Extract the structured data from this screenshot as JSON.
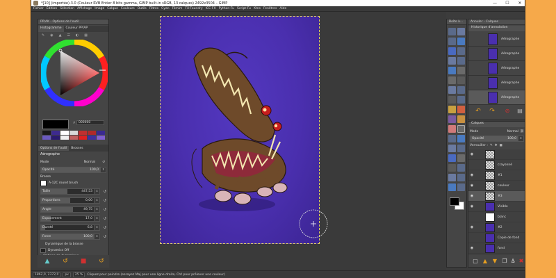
{
  "window": {
    "title": "*[10] (importée)-3.0 (Couleur RVB Entier 8 bits gamma, GIMP built-in sRGB, 13 calques) 2492x3504 – GIMP",
    "controls": [
      "—",
      "☐",
      "✕"
    ]
  },
  "menu": [
    "Fichier",
    "Édition",
    "Sélection",
    "Affichage",
    "Image",
    "Calque",
    "Couleurs",
    "Outils",
    "Filtres",
    "Cyan",
    "Filmim",
    "FX-Foundry",
    "ICC-FX",
    "Python-Fu",
    "Script-Fu",
    "Xtns",
    "Fenêtres",
    "Aide"
  ],
  "left_panel": {
    "dock_title": "PP/AK - Options de l'outil",
    "tabs": [
      "Histogramme",
      "Couleur PP/AP"
    ],
    "hex_value": "000000",
    "colors": {
      "foreground": "#000000",
      "swatches": [
        "#1a1a1a",
        "#3d2a8f",
        "#ffffff",
        "#d8d8d8",
        "#c03030",
        "#b02a2a",
        "#3a2a90",
        "#6a5ac0",
        "#2a1a70",
        "#f0f0f0",
        "#c06060",
        "#e02020",
        "#4030a0",
        "#8060d0"
      ]
    },
    "options_tabs": [
      "Options de l'outil",
      "Brosses"
    ],
    "tool_name": "Aérographe",
    "mode_label": "Mode",
    "mode_value": "Normal",
    "opacity": {
      "label": "Opacité",
      "value": "100,0",
      "fraction": 1.0
    },
    "brush_label": "Brosse",
    "brush_value": "A-12C round brush",
    "sliders": [
      {
        "label": "Taille",
        "value": "447,53",
        "fraction": 0.45
      },
      {
        "label": "Proportions",
        "value": "0,00",
        "fraction": 0.5
      },
      {
        "label": "Angle",
        "value": "49,75",
        "fraction": 0.55
      },
      {
        "label": "Espacement",
        "value": "17,0",
        "fraction": 0.17
      },
      {
        "label": "Dureté",
        "value": "6,8",
        "fraction": 0.07
      },
      {
        "label": "Force",
        "value": "100,0",
        "fraction": 1.0
      }
    ],
    "dynamics_label": "Dynamique de la brosse",
    "dynamics_value": "Dynamics Off",
    "dynamics_options": "Options de dynamique"
  },
  "right_panel": {
    "toolbox_title": "Boîte à...",
    "history_title": "Annuler - Calques",
    "history_header": "Historique d'annulation",
    "history": [
      "Aérographe",
      "Aérographe",
      "Aérographe",
      "Aérographe",
      "Aérographe"
    ],
    "layers_tab": "Calques",
    "mode_label": "Mode",
    "mode_value": "Normal",
    "opacity_label": "Opacité",
    "opacity_value": "100,0",
    "lock_label": "Verrouiller :",
    "layers": [
      {
        "name": "",
        "thumb": "checker"
      },
      {
        "name": "crayonné",
        "thumb": "checker"
      },
      {
        "name": "#1",
        "thumb": "checker"
      },
      {
        "name": "couleur",
        "thumb": "checker"
      },
      {
        "name": "#3",
        "thumb": "checker"
      },
      {
        "name": "Visible",
        "thumb": "#4a2fae"
      },
      {
        "name": "blanc",
        "thumb": "#ffffff"
      },
      {
        "name": "#2",
        "thumb": "#4a2fae"
      },
      {
        "name": "Copie de fond",
        "thumb": "#4a2fae"
      },
      {
        "name": "fond",
        "thumb": "#4a2fae"
      }
    ]
  },
  "status": {
    "coords": "1862,0, 2372,0",
    "unit": "px",
    "zoom": "25 %",
    "message": "Cliquez pour peindre (essayez Maj pour une ligne droite, Ctrl pour prélever une couleur)"
  },
  "canvas_color": "#4a2fae"
}
